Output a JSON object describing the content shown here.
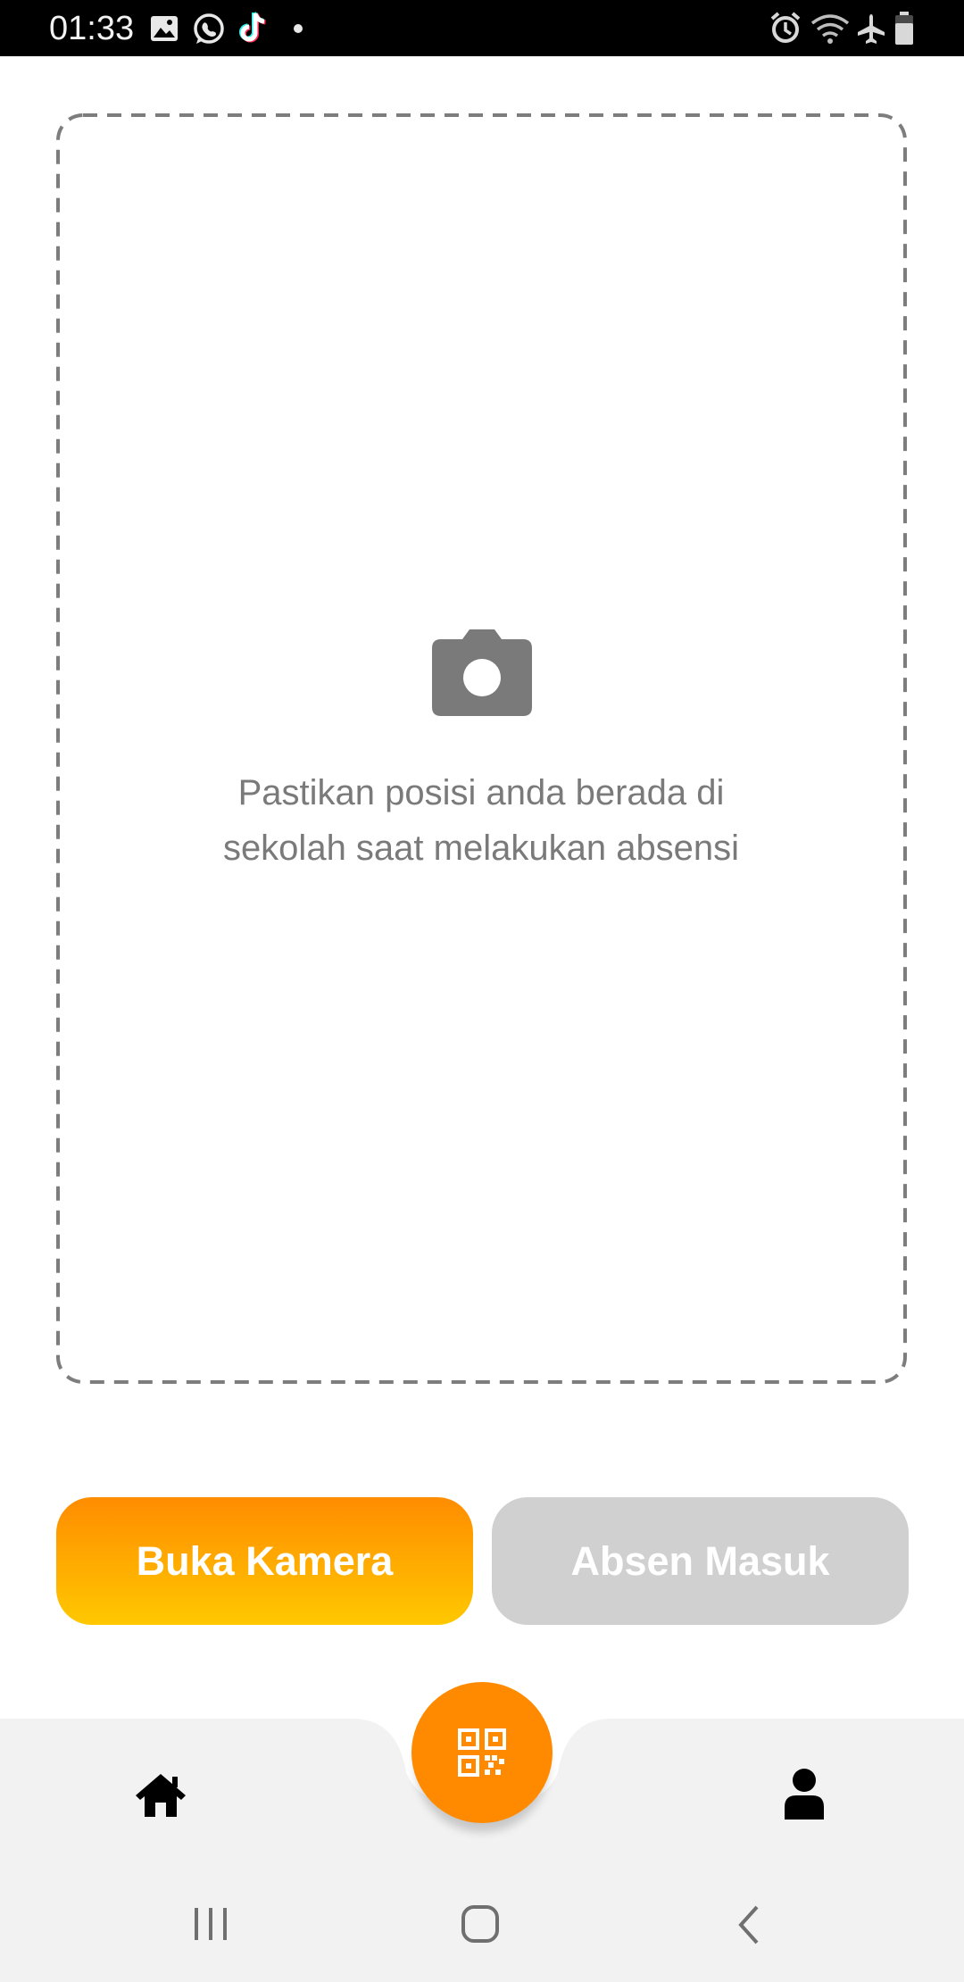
{
  "status_bar": {
    "time": "01:33",
    "left_icons": [
      "gallery-icon",
      "whatsapp-icon",
      "tiktok-icon",
      "notification-dot-icon"
    ],
    "right_icons": [
      "alarm-icon",
      "wifi-icon",
      "airplane-mode-icon",
      "battery-icon"
    ]
  },
  "photo_area": {
    "icon": "camera-icon",
    "instruction_line1": "Pastikan posisi anda berada di",
    "instruction_line2": "sekolah saat melakukan absensi"
  },
  "actions": {
    "open_camera_label": "Buka Kamera",
    "check_in_label": "Absen Masuk"
  },
  "bottom_nav": {
    "items": [
      "home-icon",
      "qr-code-icon",
      "profile-icon"
    ]
  },
  "system_nav": {
    "items": [
      "recent-apps-icon",
      "home-button-icon",
      "back-icon"
    ]
  },
  "colors": {
    "accent": "#ff8a00",
    "accent_gradient_end": "#ffc800",
    "disabled": "#d0d0d0",
    "text_muted": "#7a7a7a",
    "nav_background": "#f2f2f2"
  }
}
